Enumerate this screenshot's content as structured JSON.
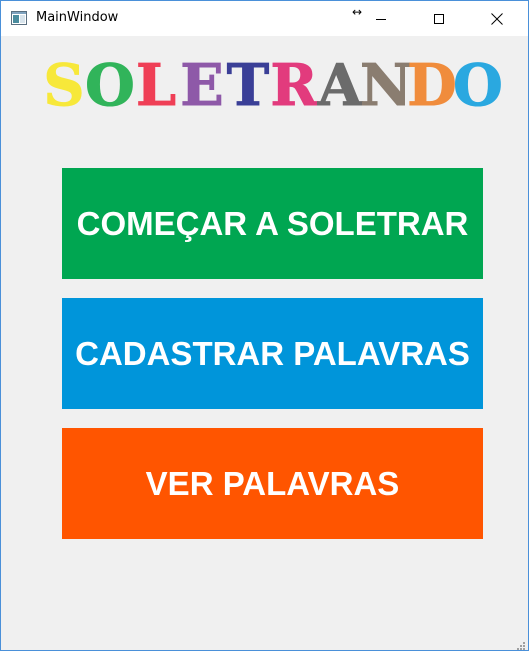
{
  "window": {
    "title": "MainWindow",
    "resize_glyph": "↔"
  },
  "logo": {
    "letters": [
      "S",
      "O",
      "L",
      "E",
      "T",
      "R",
      "A",
      "N",
      "D",
      "O"
    ],
    "colors": [
      "#f7e83a",
      "#31b45a",
      "#ef3f56",
      "#8e59a8",
      "#3a3f97",
      "#e23b7d",
      "#6b6b6b",
      "#8a7d70",
      "#f08c3c",
      "#2aa8e0"
    ]
  },
  "buttons": {
    "start": {
      "label": "COMEÇAR A SOLETRAR",
      "color": "#00a651"
    },
    "register": {
      "label": "CADASTRAR PALAVRAS",
      "color": "#0095da"
    },
    "view": {
      "label": "VER PALAVRAS",
      "color": "#ff5500"
    }
  },
  "icons": {
    "app": "window-app-icon",
    "minimize": "minimize-icon",
    "maximize": "maximize-icon",
    "close": "close-icon",
    "resize": "resize-arrows-icon",
    "grip": "resize-grip-icon"
  }
}
